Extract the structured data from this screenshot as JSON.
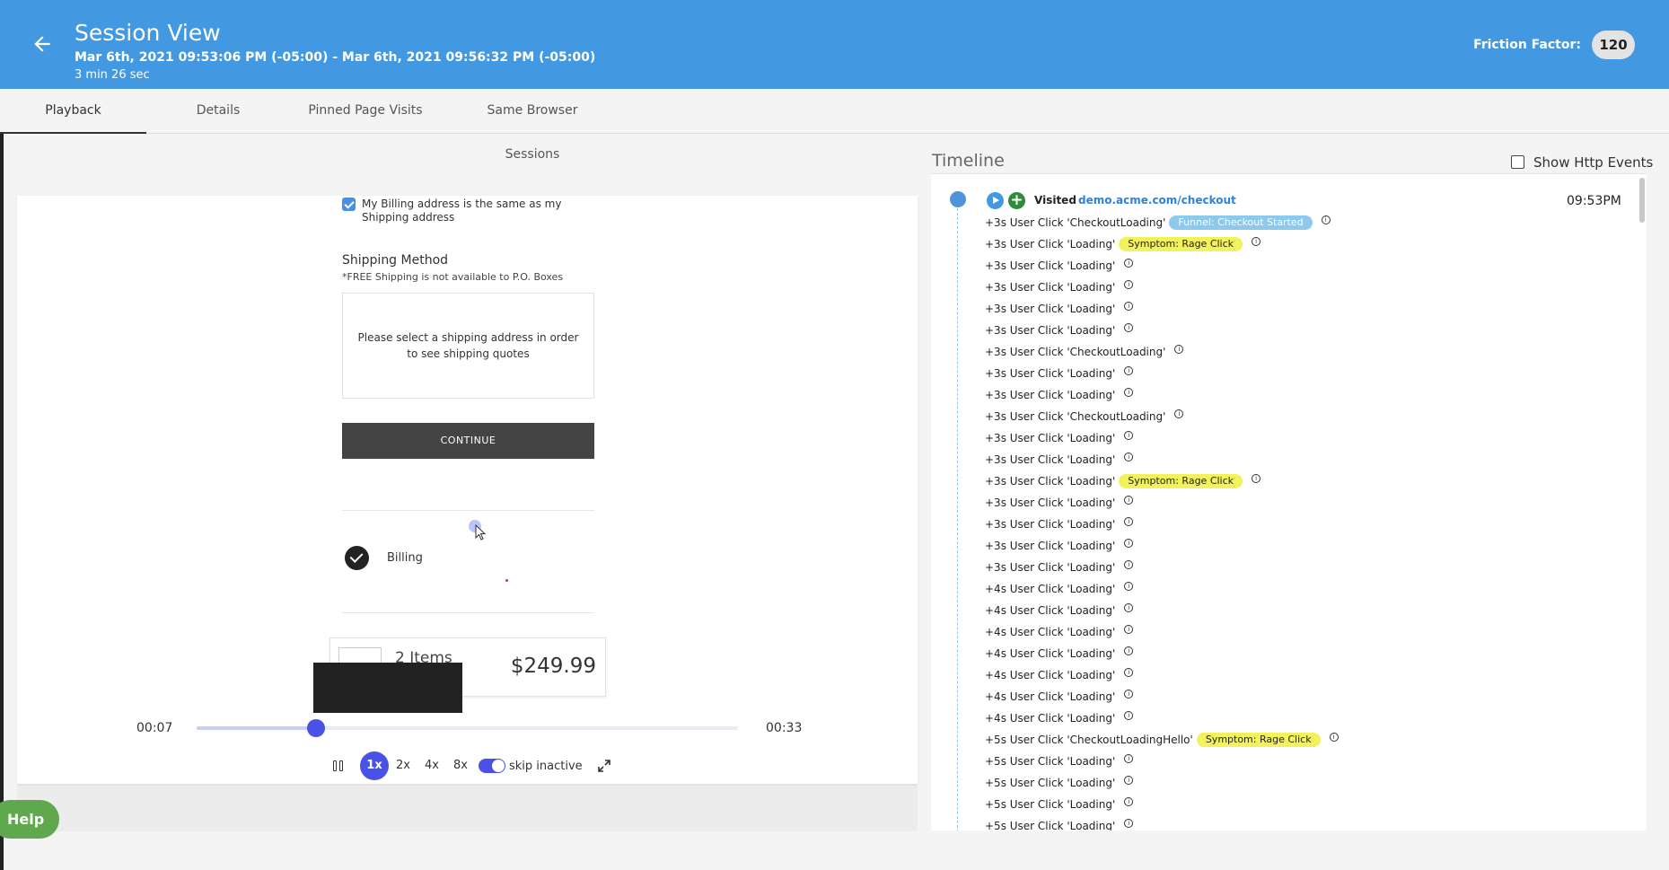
{
  "header": {
    "title": "Session View",
    "range": "Mar 6th, 2021 09:53:06 PM (-05:00) - Mar 6th, 2021 09:56:32 PM (-05:00)",
    "duration": "3 min 26 sec",
    "friction_label": "Friction Factor:",
    "friction_value": "120"
  },
  "tabs": [
    {
      "label": "Playback",
      "active": true
    },
    {
      "label": "Details"
    },
    {
      "label": "Pinned Page Visits"
    },
    {
      "label": "Same Browser Sessions"
    }
  ],
  "player": {
    "billing_same": "My Billing address is the same as my Shipping address",
    "shipping_title": "Shipping Method",
    "shipping_note": "*FREE Shipping is not available to P.O. Boxes",
    "shipping_box": "Please select a shipping address in order to see shipping quotes",
    "continue": "CONTINUE",
    "billing": "Billing",
    "cart_items": "2 Items",
    "cart_price": "$249.99",
    "current_time": "00:07",
    "total_time": "00:33",
    "progress": 0.22,
    "speeds": [
      "1x",
      "2x",
      "4x",
      "8x"
    ],
    "active_speed": "1x",
    "skip_inactive": "skip inactive",
    "skip_inactive_on": true
  },
  "help": "Help",
  "timeline": {
    "title": "Timeline",
    "show_http": "Show Http Events",
    "visited": "Visited",
    "url": "demo.acme.com/checkout",
    "time": "09:53PM",
    "events": [
      {
        "text": "+3s User Click 'CheckoutLoading'",
        "badge": "Funnel: Checkout Started",
        "badge_type": "funnel"
      },
      {
        "text": "+3s User Click 'Loading'",
        "badge": "Symptom: Rage Click",
        "badge_type": "rage"
      },
      {
        "text": "+3s User Click 'Loading'"
      },
      {
        "text": "+3s User Click 'Loading'"
      },
      {
        "text": "+3s User Click 'Loading'"
      },
      {
        "text": "+3s User Click 'Loading'"
      },
      {
        "text": "+3s User Click 'CheckoutLoading'"
      },
      {
        "text": "+3s User Click 'Loading'"
      },
      {
        "text": "+3s User Click 'Loading'"
      },
      {
        "text": "+3s User Click 'CheckoutLoading'"
      },
      {
        "text": "+3s User Click 'Loading'"
      },
      {
        "text": "+3s User Click 'Loading'"
      },
      {
        "text": "+3s User Click 'Loading'",
        "badge": "Symptom: Rage Click",
        "badge_type": "rage"
      },
      {
        "text": "+3s User Click 'Loading'"
      },
      {
        "text": "+3s User Click 'Loading'"
      },
      {
        "text": "+3s User Click 'Loading'"
      },
      {
        "text": "+3s User Click 'Loading'"
      },
      {
        "text": "+4s User Click 'Loading'"
      },
      {
        "text": "+4s User Click 'Loading'"
      },
      {
        "text": "+4s User Click 'Loading'"
      },
      {
        "text": "+4s User Click 'Loading'"
      },
      {
        "text": "+4s User Click 'Loading'"
      },
      {
        "text": "+4s User Click 'Loading'"
      },
      {
        "text": "+4s User Click 'Loading'"
      },
      {
        "text": "+5s User Click 'CheckoutLoadingHello'",
        "badge": "Symptom: Rage Click",
        "badge_type": "rage"
      },
      {
        "text": "+5s User Click 'Loading'"
      },
      {
        "text": "+5s User Click 'Loading'"
      },
      {
        "text": "+5s User Click 'Loading'"
      },
      {
        "text": "+5s User Click 'Loading'"
      }
    ]
  }
}
